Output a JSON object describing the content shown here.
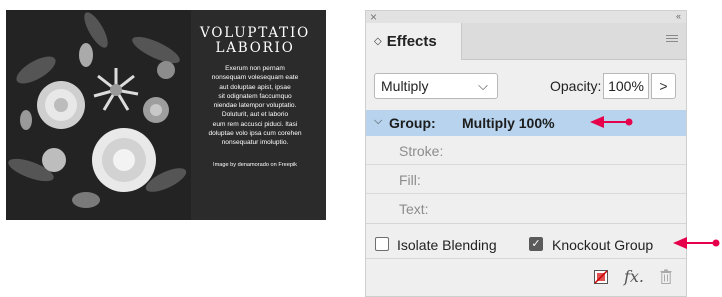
{
  "artwork": {
    "title": "VOLUPTATIO\nLABORIO",
    "body": "Exerum non pernam\nnonsequam volesequam eate\naut doluptae apist, ipsae\nsit odignatem faccumquo\nniendae latempor voluptatio.\nDoluturit, aut et laborio\neum rem accusci piduci. Itasi\ndoluptae volo ipsa cum corehen\nnonsequatur imoluptio.",
    "credit": "Image by denamorado on Freepik"
  },
  "panel": {
    "close_glyph": "×",
    "collapse_glyph": "‹‹",
    "tab_label": "Effects",
    "blend_mode": "Multiply",
    "opacity_label": "Opacity:",
    "opacity_value": "100%",
    "opacity_arrow": ">",
    "group_label": "Group:",
    "group_value": "Multiply 100%",
    "attributes": [
      "Stroke:",
      "Fill:",
      "Text:"
    ],
    "isolate_label": "Isolate Blending",
    "isolate_checked": false,
    "knockout_label": "Knockout Group",
    "knockout_checked": true,
    "fx_label": "fx."
  },
  "colors": {
    "highlight_row": "#b7d3ee",
    "annotation_arrow": "#e6004c",
    "panel_bg": "#efefef"
  }
}
